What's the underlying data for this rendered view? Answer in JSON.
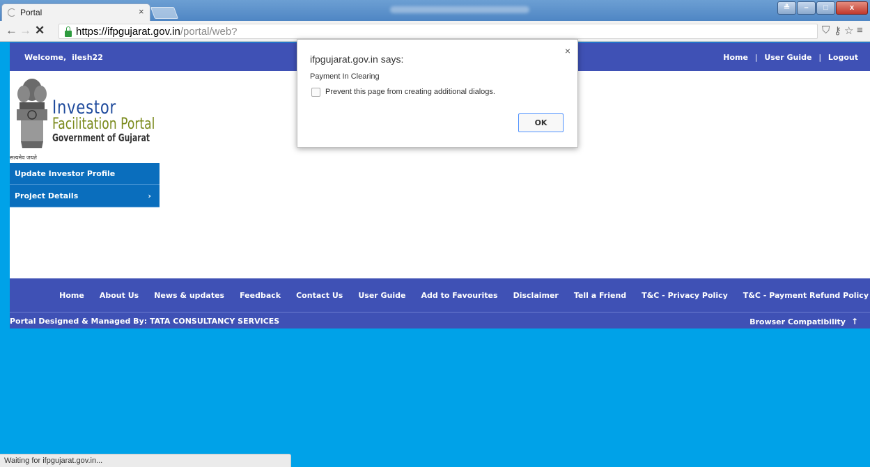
{
  "browser": {
    "tab_title": "Portal",
    "tab_close": "×",
    "url_host": "https://ifpgujarat.gov.in",
    "url_path": "/portal/web?",
    "back_glyph": "←",
    "forward_glyph": "→",
    "stop_glyph": "✕",
    "shield_glyph": "⛉",
    "key_glyph": "⚷",
    "star_glyph": "☆",
    "menu_glyph": "≡",
    "window_controls": {
      "minimize": "–",
      "maximize": "□",
      "close": "x",
      "user": "≗"
    }
  },
  "topbar": {
    "welcome_label": "Welcome,",
    "username": "ilesh22",
    "links": [
      "Home",
      "User Guide",
      "Logout"
    ],
    "separator": "|"
  },
  "logo": {
    "line1": "Investor",
    "line2": "Facilitation Portal",
    "line3": "Government of Gujarat",
    "emblem_caption": "सत्यमेव जयते"
  },
  "sidemenu": {
    "items": [
      {
        "label": "Update Investor Profile",
        "has_submenu": false
      },
      {
        "label": "Project Details",
        "has_submenu": true,
        "chevron": "›"
      }
    ]
  },
  "footer": {
    "links": [
      "Home",
      "About Us",
      "News & updates",
      "Feedback",
      "Contact Us",
      "User Guide",
      "Add to Favourites",
      "Disclaimer",
      "Tell a Friend",
      "T&C - Privacy Policy",
      "T&C - Payment Refund Policy"
    ],
    "designed_by": "Portal Designed & Managed By: TATA CONSULTANCY SERVICES",
    "browser_compat": "Browser Compatibility",
    "up_arrow": "↑"
  },
  "dialog": {
    "title": "ifpgujarat.gov.in says:",
    "close": "×",
    "message": "Payment In Clearing",
    "checkbox_label": "Prevent this page from creating additional dialogs.",
    "checkbox_checked": false,
    "ok_label": "OK"
  },
  "status_bar": {
    "text": "Waiting for ifpgujarat.gov.in..."
  },
  "colors": {
    "page_background": "#00a2e8",
    "header_bar": "#3f51b5",
    "side_menu": "#0a6ebd",
    "logo_blue": "#1e4a9c",
    "logo_olive": "#7a8a1c"
  }
}
